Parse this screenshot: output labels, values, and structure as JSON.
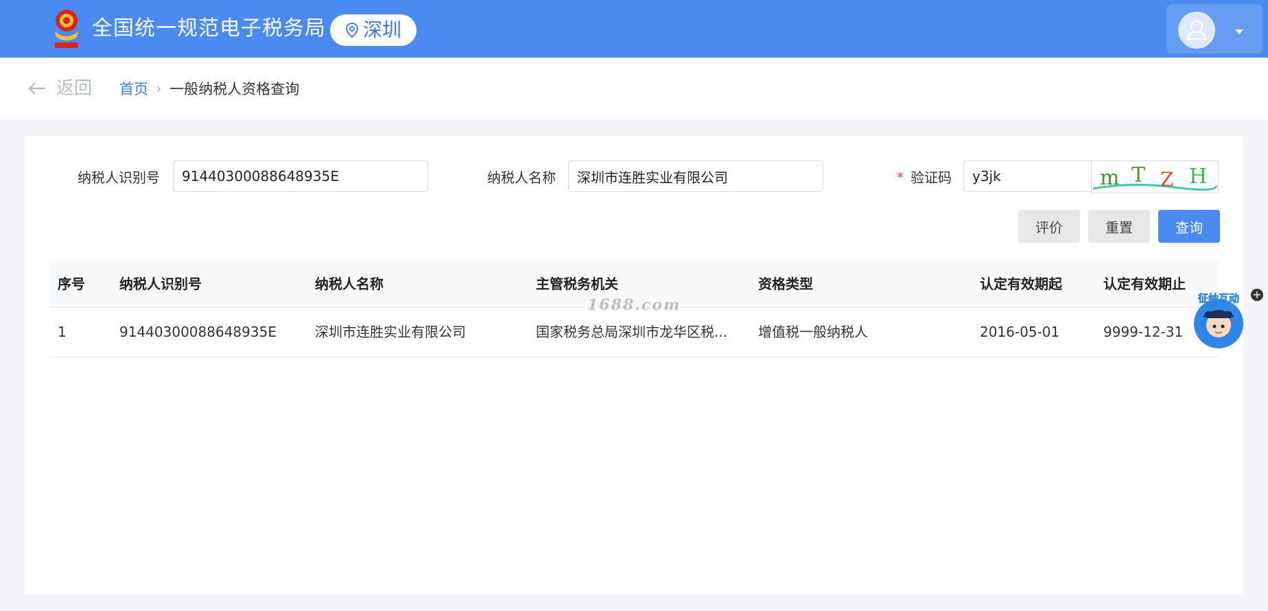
{
  "header": {
    "site_title": "全国统一规范电子税务局",
    "region": "深圳",
    "emblem_icon": "national-emblem-icon",
    "user_icon": "user-avatar-icon"
  },
  "breadcrumb": {
    "back_label": "返回",
    "home": "首页",
    "current": "一般纳税人资格查询"
  },
  "form": {
    "taxpayer_id_label": "纳税人识别号",
    "taxpayer_id_value": "91440300088648935E",
    "taxpayer_name_label": "纳税人名称",
    "taxpayer_name_value": "深圳市连胜实业有限公司",
    "captcha_required_mark": "*",
    "captcha_label": "验证码",
    "captcha_value": "y3jk",
    "captcha_image_text": "mTZH"
  },
  "buttons": {
    "rate": "评价",
    "reset": "重置",
    "query": "查询"
  },
  "table": {
    "headers": [
      "序号",
      "纳税人识别号",
      "纳税人名称",
      "主管税务机关",
      "资格类型",
      "认定有效期起",
      "认定有效期止"
    ],
    "rows": [
      [
        "1",
        "91440300088648935E",
        "深圳市连胜实业有限公司",
        "国家税务总局深圳市龙华区税...",
        "增值税一般纳税人",
        "2016-05-01",
        "9999-12-31"
      ]
    ]
  },
  "watermark": "1688.com",
  "assistant": {
    "label": "征纳互动",
    "plus": "+"
  },
  "colors": {
    "header_bg": "#4a8af1",
    "primary": "#4a8af1",
    "link": "#3d7de0",
    "required": "#e5484d"
  }
}
